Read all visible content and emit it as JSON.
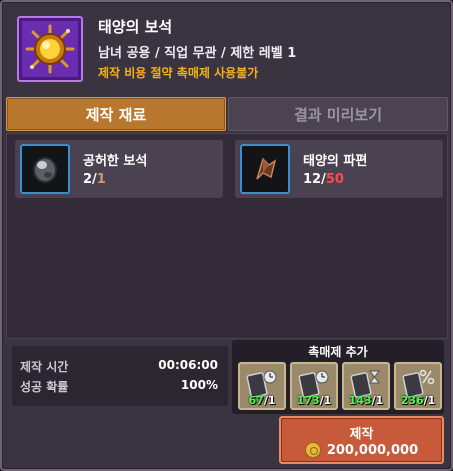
{
  "item": {
    "name": "태양의 보석",
    "requirements": "남녀 공용 / 직업 무관 / 제한 레벨 1",
    "notice": "제작 비용 절약 촉매제 사용불가"
  },
  "tabs": [
    {
      "label": "제작 재료",
      "active": true
    },
    {
      "label": "결과 미리보기",
      "active": false
    }
  ],
  "materials": [
    {
      "name": "공허한 보석",
      "have": "2",
      "need": "1",
      "icon": "gem-icon"
    },
    {
      "name": "태양의 파편",
      "have": "12",
      "need": "50",
      "icon": "fragment-icon"
    }
  ],
  "info": {
    "time_label": "제작 시간",
    "time_value": "00:06:00",
    "rate_label": "성공 확률",
    "rate_value": "100%"
  },
  "catalyst": {
    "title": "촉매제 추가",
    "slots": [
      {
        "count": "67",
        "max": "1",
        "icon": "catalyst-clock-icon"
      },
      {
        "count": "173",
        "max": "1",
        "icon": "catalyst-clock-icon"
      },
      {
        "count": "143",
        "max": "1",
        "icon": "catalyst-hourglass-icon"
      },
      {
        "count": "236",
        "max": "1",
        "icon": "catalyst-percent-icon"
      }
    ]
  },
  "craft": {
    "label": "제작",
    "cost": "200,000,000"
  },
  "colors": {
    "accent_tab": "#b8772e",
    "notice": "#f3b21a",
    "item_frame": "#6a2cb0",
    "craft_button": "#c65a3a",
    "shortage": "#ff4a4a",
    "stock_ok": "#44ff44"
  }
}
